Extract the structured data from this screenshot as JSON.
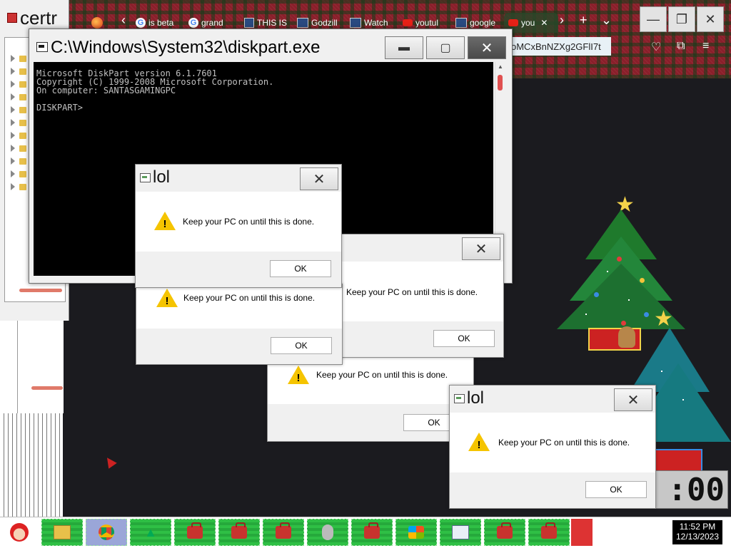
{
  "browser": {
    "tabs": [
      {
        "label": "is beta",
        "icon": "google-icon"
      },
      {
        "label": "grand",
        "icon": "google-icon"
      },
      {
        "label": "THIS IS",
        "icon": "window-icon"
      },
      {
        "label": "Godzill",
        "icon": "window-icon"
      },
      {
        "label": "Watch",
        "icon": "window-icon"
      },
      {
        "label": "youtul",
        "icon": "youtube-icon"
      },
      {
        "label": "google",
        "icon": "window-icon"
      },
      {
        "label": "you",
        "icon": "youtube-icon"
      }
    ],
    "url_fragment": "oMCxBnNZXg2GFlI7t",
    "new_tab": "+",
    "tab_list": "⌄"
  },
  "left_window": {
    "title": "certr"
  },
  "console": {
    "title": "C:\\Windows\\System32\\diskpart.exe",
    "lines": [
      "Microsoft DiskPart version 6.1.7601",
      "Copyright (C) 1999-2008 Microsoft Corporation.",
      "On computer: SANTASGAMINGPC",
      "",
      "DISKPART>"
    ]
  },
  "dialogs": [
    {
      "title": "lol",
      "message": "Keep your PC on until this is done.",
      "ok": "OK"
    },
    {
      "title": "",
      "message": "Keep your PC on until this is done.",
      "ok": "OK"
    },
    {
      "title": "",
      "message": "Keep your PC on until this is done.",
      "ok": "OK"
    },
    {
      "title": "",
      "message": "Keep your PC on until this is done.",
      "ok": "OK"
    },
    {
      "title": "lol",
      "message": "Keep your PC on until this is done.",
      "ok": "OK"
    }
  ],
  "desktop_clock": ":00",
  "taskbar": {
    "time": "11:52 PM",
    "date": "12/13/2023"
  },
  "colors": {
    "taskbar_green": "#2fbf45",
    "warning_yellow": "#f5c400",
    "console_bg": "#000000",
    "plaid_red": "#8a1f2a"
  }
}
